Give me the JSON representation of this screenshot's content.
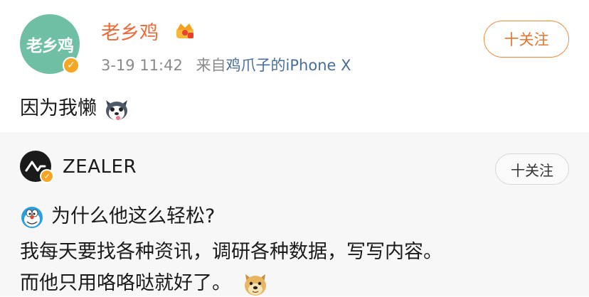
{
  "post": {
    "avatar_text": "老乡鸡",
    "username": "老乡鸡",
    "timestamp": "3-19 11:42",
    "source_prefix": "来自",
    "source_name": "鸡爪子的iPhone X",
    "follow_label": "十关注",
    "text": "因为我懒",
    "emoji": "husky-emoji"
  },
  "repost": {
    "username": "ZEALER",
    "follow_label": "十关注",
    "line1": "为什么他这么轻松?",
    "line2": "我每天要找各种资讯，调研各种数据，写写内容。",
    "line3": "而他只用咯咯哒就好了。"
  },
  "colors": {
    "username": "#e86c3a",
    "follow_border": "#f08a3c",
    "source_link": "#4a6e99",
    "avatar_bg": "#6fbfa5",
    "repost_bg": "#f7f7f7"
  }
}
